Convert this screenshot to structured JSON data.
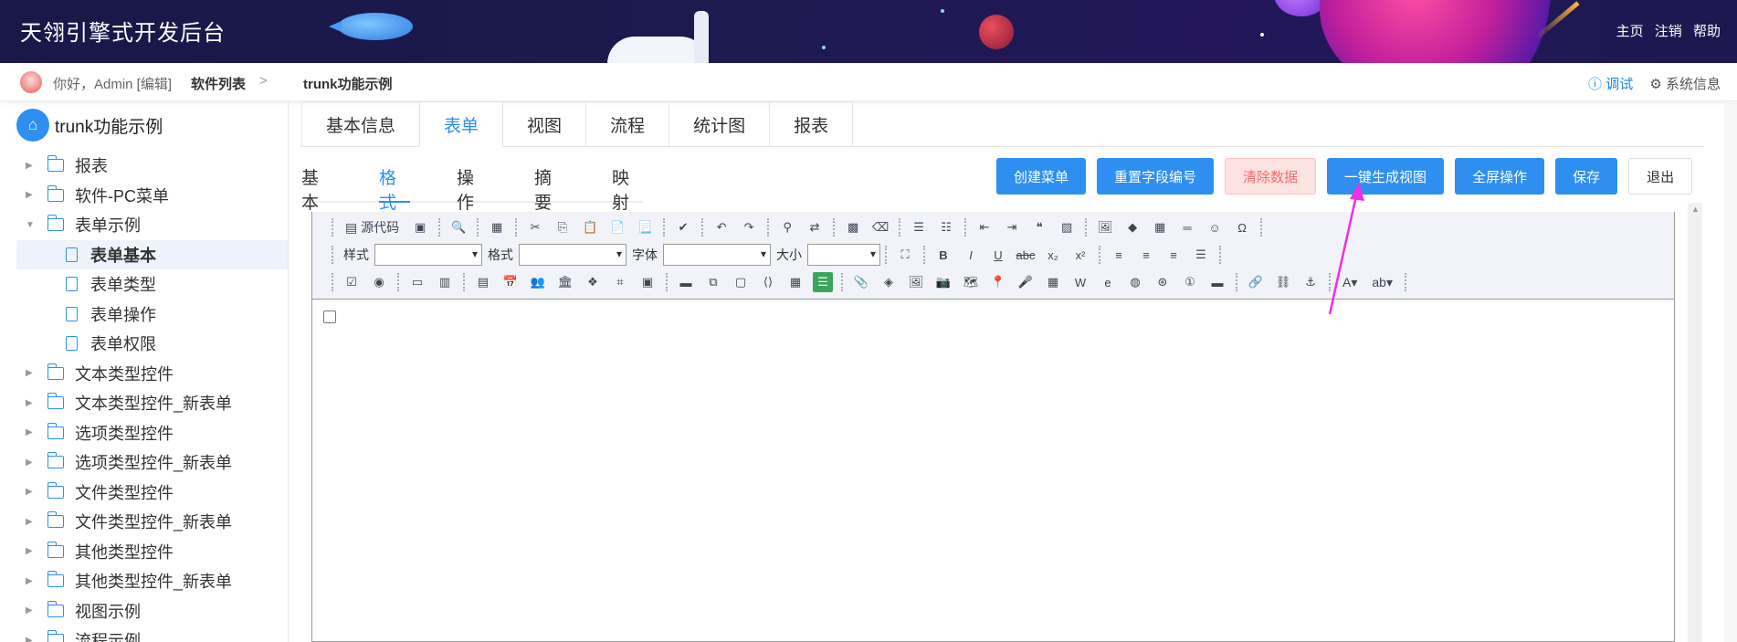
{
  "header": {
    "title": "天翎引擎式开发后台",
    "links": [
      "主页",
      "注销",
      "帮助"
    ]
  },
  "breadcrumb": {
    "greeting": "你好，Admin [编辑]",
    "items": [
      "软件列表",
      "trunk功能示例"
    ],
    "separator": ">",
    "debug_label": "ⓘ 调试",
    "sysinfo_label": "⚙ 系统信息"
  },
  "sidebar": {
    "root_label": "trunk功能示例",
    "items": [
      {
        "label": "报表",
        "type": "folder",
        "expanded": false
      },
      {
        "label": "软件-PC菜单",
        "type": "folder",
        "expanded": false
      },
      {
        "label": "表单示例",
        "type": "folder",
        "expanded": true
      },
      {
        "label": "表单基本",
        "type": "doc",
        "active": true
      },
      {
        "label": "表单类型",
        "type": "doc"
      },
      {
        "label": "表单操作",
        "type": "doc"
      },
      {
        "label": "表单权限",
        "type": "doc"
      },
      {
        "label": "文本类型控件",
        "type": "folder"
      },
      {
        "label": "文本类型控件_新表单",
        "type": "folder"
      },
      {
        "label": "选项类型控件",
        "type": "folder"
      },
      {
        "label": "选项类型控件_新表单",
        "type": "folder"
      },
      {
        "label": "文件类型控件",
        "type": "folder"
      },
      {
        "label": "文件类型控件_新表单",
        "type": "folder"
      },
      {
        "label": "其他类型控件",
        "type": "folder"
      },
      {
        "label": "其他类型控件_新表单",
        "type": "folder"
      },
      {
        "label": "视图示例",
        "type": "folder"
      },
      {
        "label": "流程示例",
        "type": "folder"
      }
    ]
  },
  "main_tabs": [
    "基本信息",
    "表单",
    "视图",
    "流程",
    "统计图",
    "报表"
  ],
  "main_tabs_active": 1,
  "sub_tabs": [
    "基本",
    "格式",
    "操作",
    "摘要",
    "映射"
  ],
  "sub_tabs_active": 1,
  "buttons": {
    "create_menu": "创建菜单",
    "reset_ids": "重置字段编号",
    "clear_data": "清除数据",
    "gen_view": "一键生成视图",
    "fullscreen": "全屏操作",
    "save": "保存",
    "exit": "退出"
  },
  "editor": {
    "source_label": "源代码",
    "style_label": "样式",
    "format_label": "格式",
    "font_label": "字体",
    "size_label": "大小",
    "bold": "B",
    "italic": "I",
    "underline": "U",
    "strike": "abc",
    "sub": "x₂",
    "sup": "x²",
    "omega": "Ω"
  },
  "colors": {
    "accent": "#2e8ff0",
    "header_bg": "#1a1848",
    "danger_bg": "#fde2e2",
    "danger_text": "#f56c6c",
    "annotation_arrow": "#f02ee8"
  }
}
